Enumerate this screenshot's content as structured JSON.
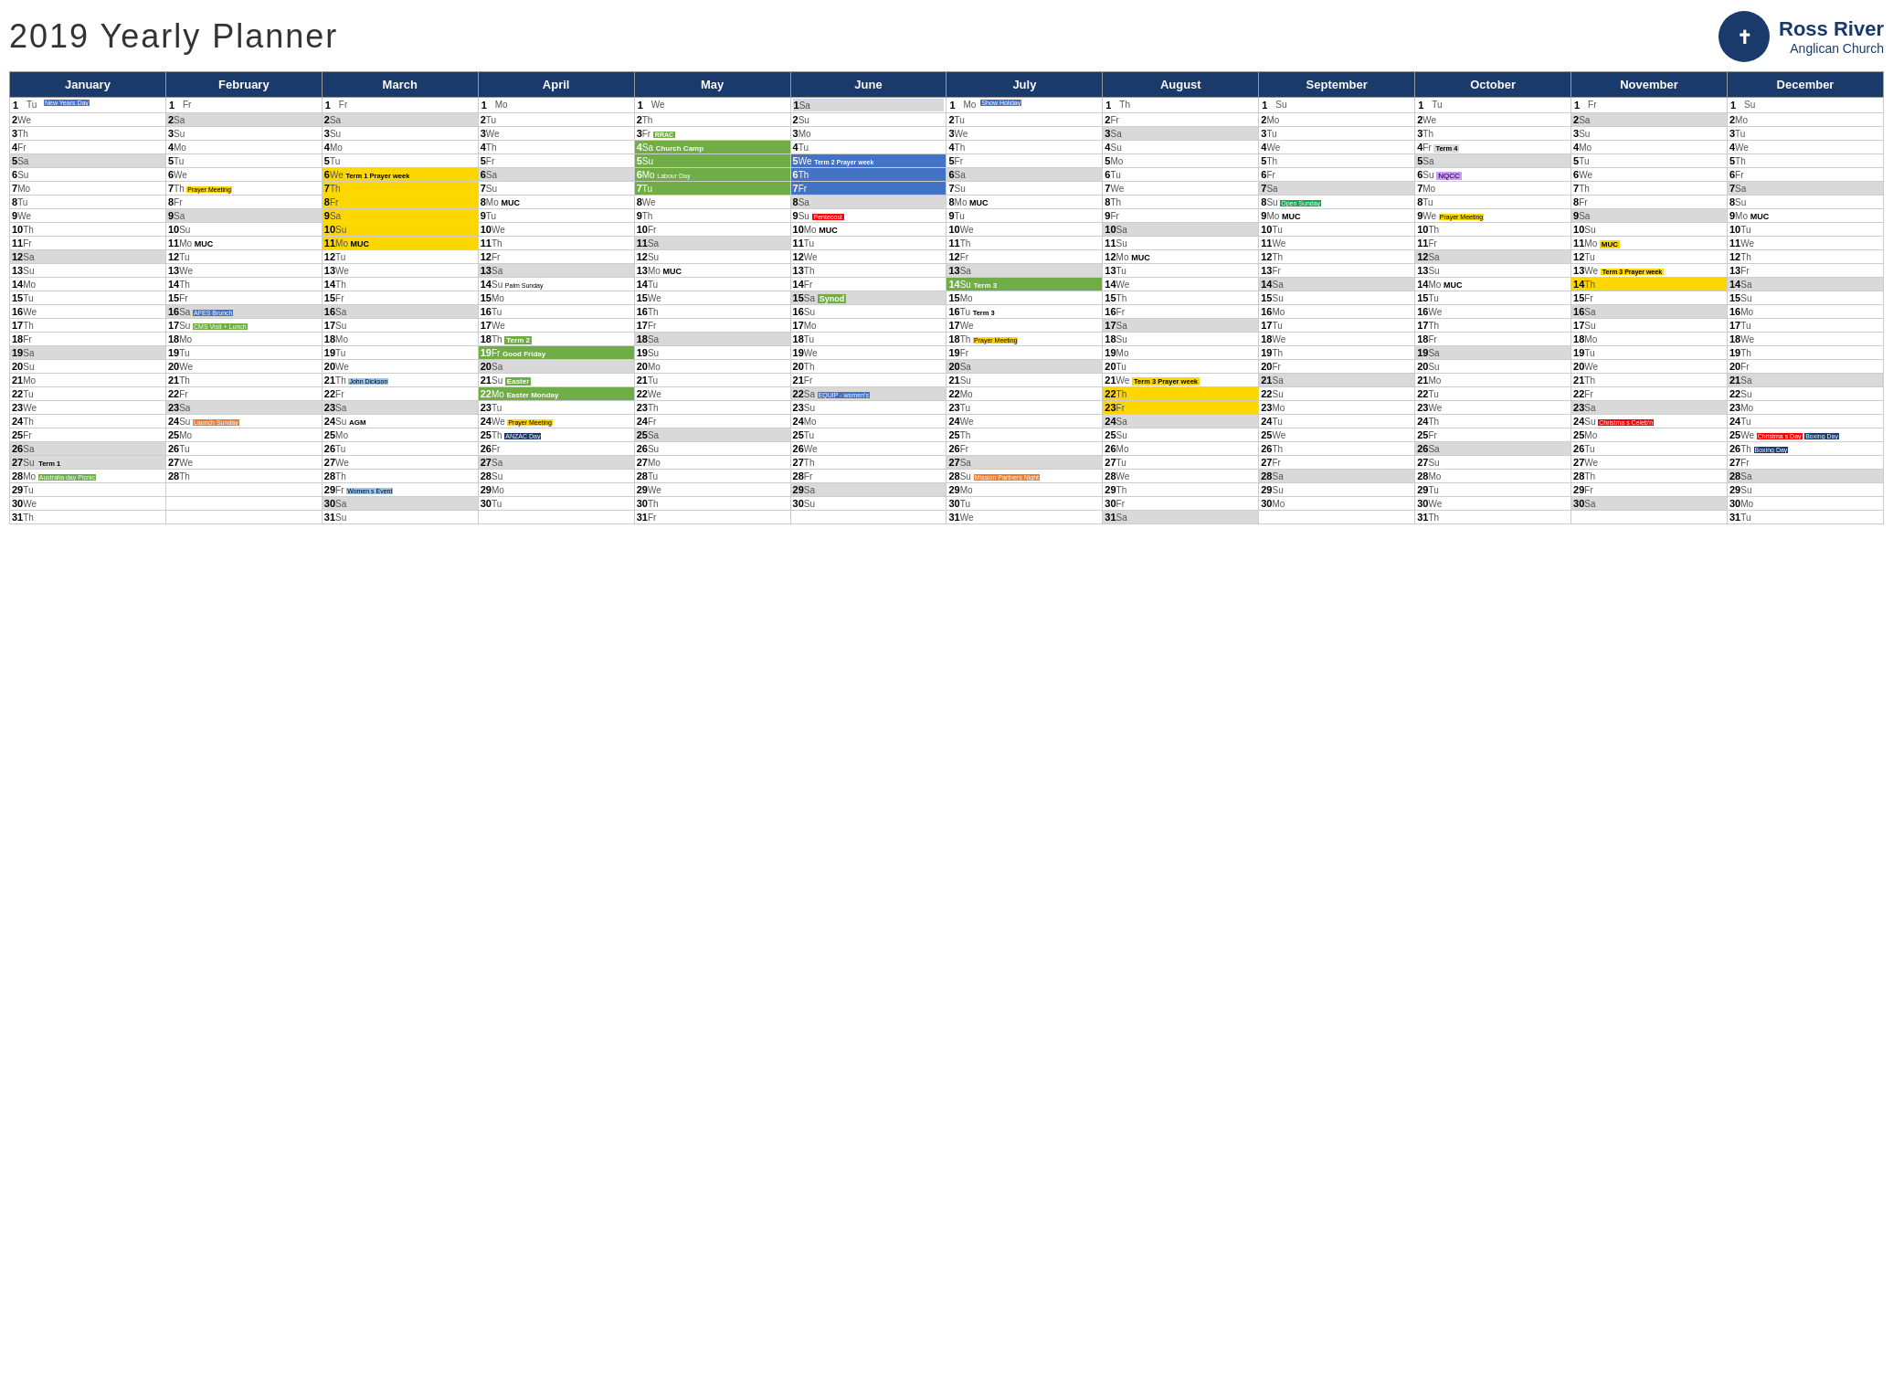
{
  "header": {
    "title": "2019 Yearly Planner",
    "logo_name": "Ross River",
    "logo_subtitle": "Anglican Church"
  },
  "months": [
    "January",
    "February",
    "March",
    "April",
    "May",
    "June",
    "July",
    "August",
    "September",
    "October",
    "November",
    "December"
  ],
  "accent_color": "#1a3a6b"
}
